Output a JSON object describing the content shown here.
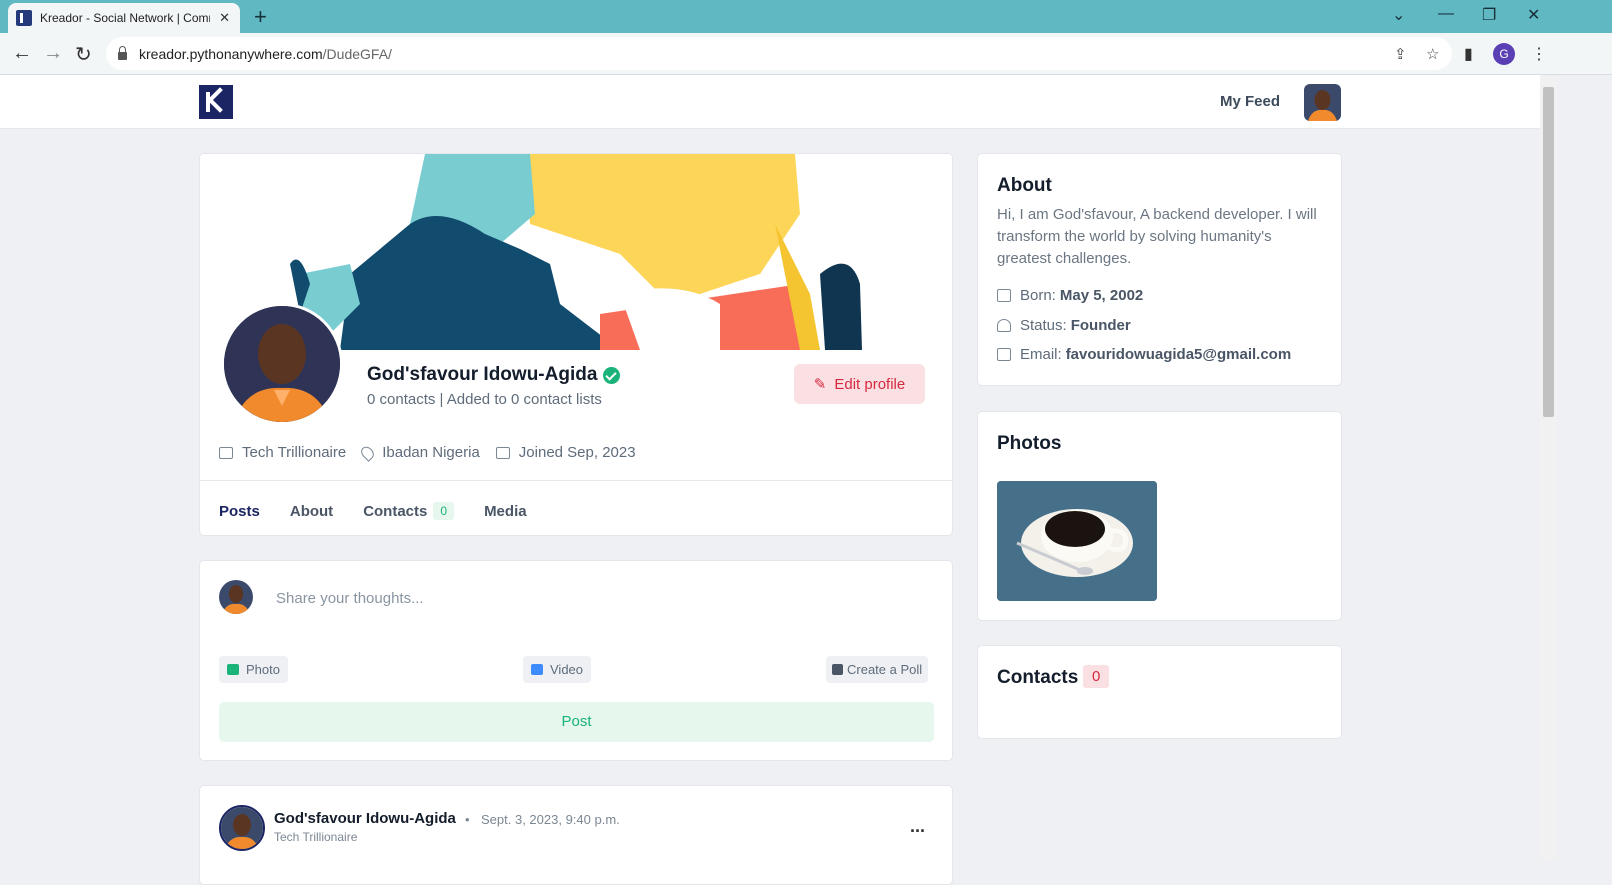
{
  "browser": {
    "tab_title": "Kreador - Social Network | Comm",
    "tab_close": "✕",
    "new_tab": "+",
    "url_host": "kreador.pythonanywhere.com",
    "url_path": "/DudeGFA/",
    "profile_initial": "G"
  },
  "header": {
    "my_feed": "My Feed"
  },
  "profile": {
    "name": "God'sfavour Idowu-Agida",
    "stats": "0 contacts | Added to 0 contact lists",
    "edit_label": "Edit profile",
    "occupation": "Tech Trillionaire",
    "location": "Ibadan Nigeria",
    "joined": "Joined Sep, 2023",
    "tabs": [
      {
        "label": "Posts"
      },
      {
        "label": "About"
      },
      {
        "label": "Contacts",
        "badge": "0"
      },
      {
        "label": "Media"
      }
    ]
  },
  "composer": {
    "placeholder": "Share your thoughts...",
    "photo": "Photo",
    "video": "Video",
    "poll": "Create a Poll",
    "post": "Post"
  },
  "post": {
    "author": "God'sfavour Idowu-Agida",
    "separator": "•",
    "date": "Sept. 3, 2023, 9:40 p.m.",
    "subtitle": "Tech Trillionaire",
    "more": "..."
  },
  "about": {
    "title": "About",
    "bio": "Hi, I am God'sfavour, A backend developer. I will transform the world by solving humanity's greatest challenges.",
    "born_label": "Born:",
    "born_value": "May 5, 2002",
    "status_label": "Status:",
    "status_value": "Founder",
    "email_label": "Email:",
    "email_value": "favouridowuagida5@gmail.com"
  },
  "photos": {
    "title": "Photos"
  },
  "contacts": {
    "title": "Contacts",
    "count": "0"
  },
  "colors": {
    "brand": "#1c2564",
    "danger": "#d6293e",
    "success": "#1ab37a",
    "chrome": "#5fb8c2"
  }
}
